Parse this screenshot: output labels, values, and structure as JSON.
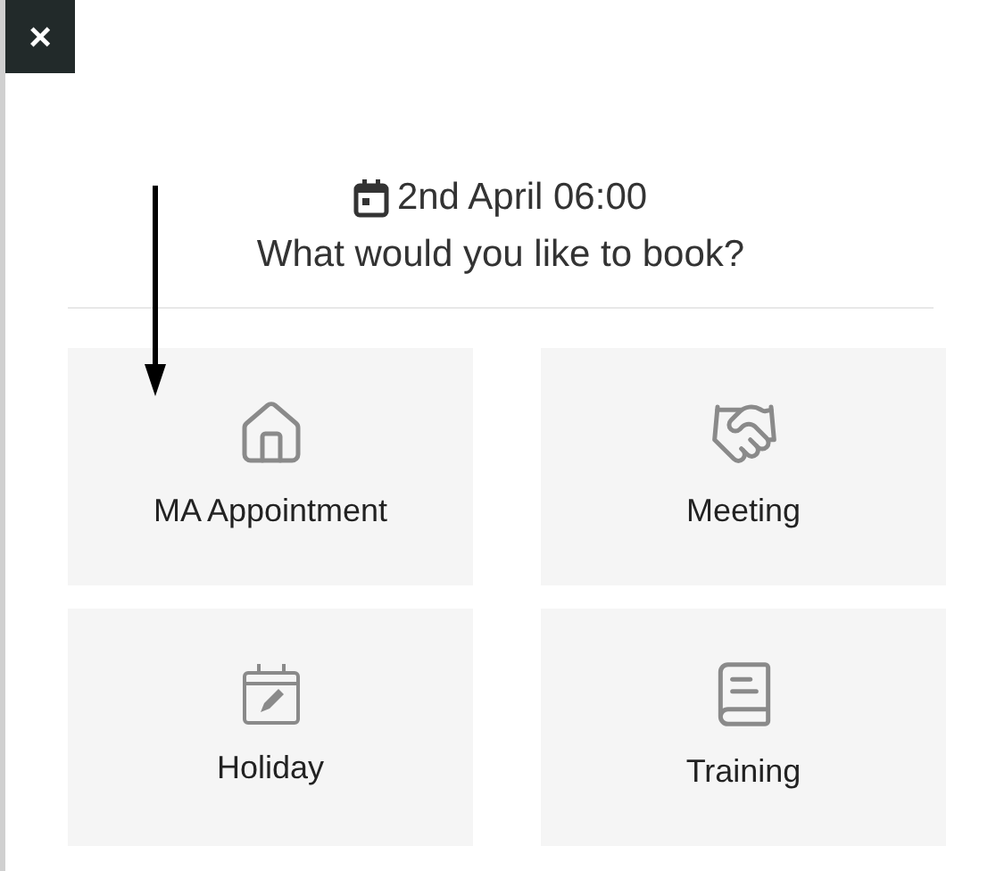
{
  "close_button": {
    "label": "×"
  },
  "header": {
    "date": "2nd April 06:00",
    "question": "What would you like to book?"
  },
  "options": [
    {
      "kind": "house",
      "label": "MA Appointment"
    },
    {
      "kind": "handshake",
      "label": "Meeting"
    },
    {
      "kind": "calendar",
      "label": "Holiday"
    },
    {
      "kind": "book",
      "label": "Training"
    }
  ]
}
